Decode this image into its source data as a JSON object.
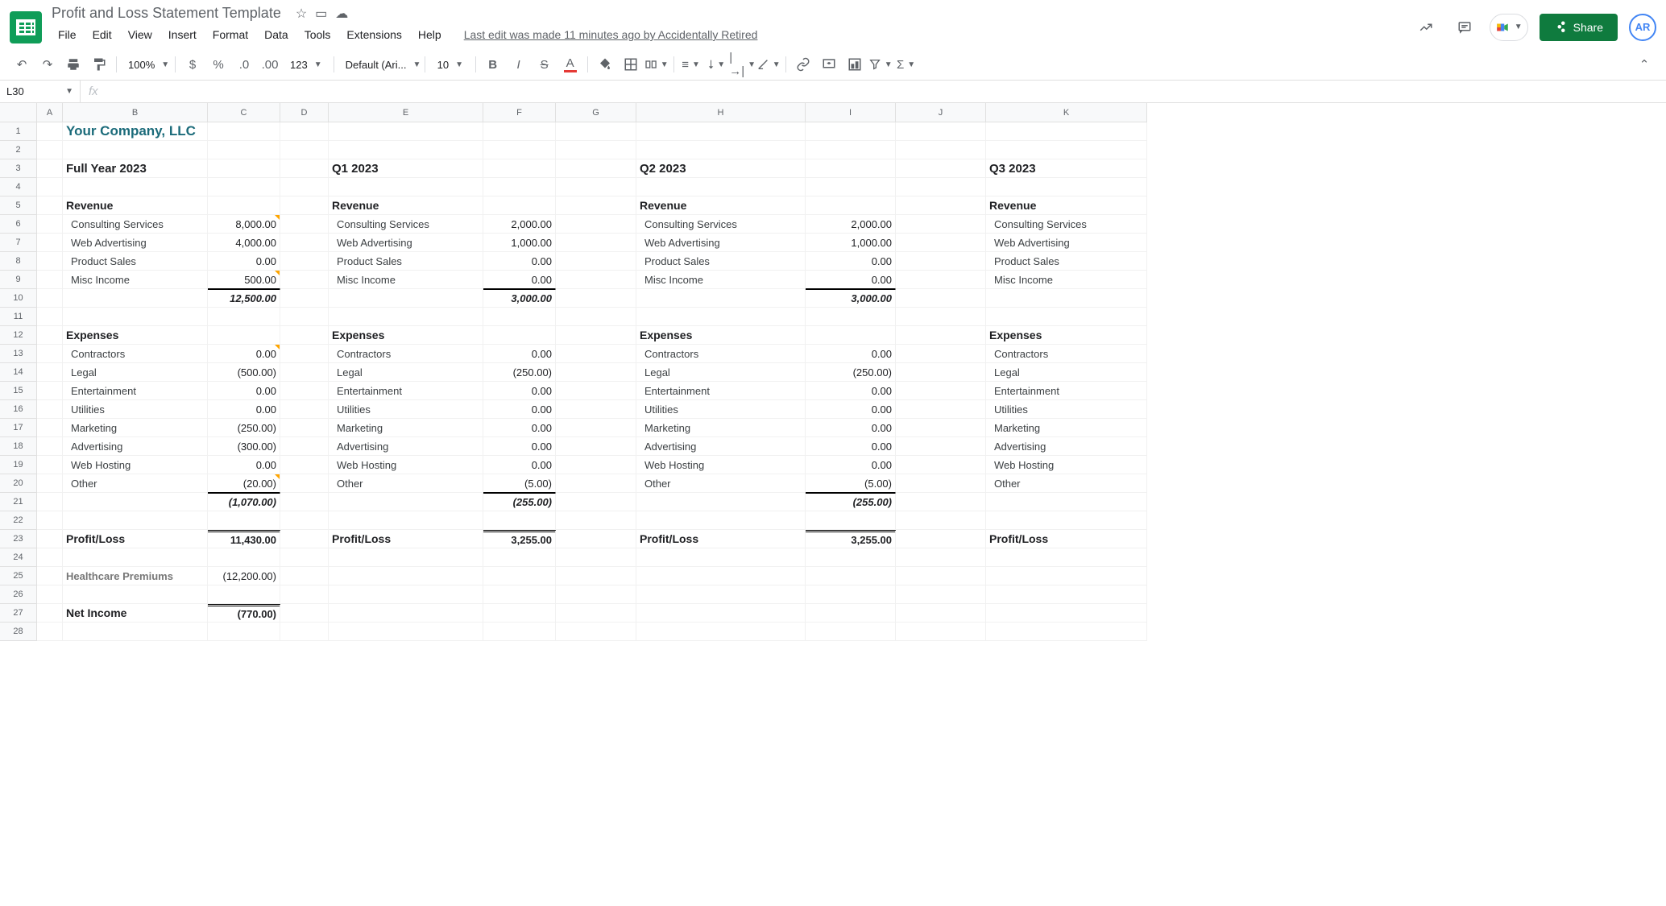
{
  "doc": {
    "title": "Profit and Loss Statement Template"
  },
  "lastEdit": "Last edit was made 11 minutes ago by Accidentally Retired",
  "menu": [
    "File",
    "Edit",
    "View",
    "Insert",
    "Format",
    "Data",
    "Tools",
    "Extensions",
    "Help"
  ],
  "share": "Share",
  "avatar": "AR",
  "toolbar": {
    "zoom": "100%",
    "font": "Default (Ari...",
    "fontSize": "10"
  },
  "nameBox": "L30",
  "columns": [
    "A",
    "B",
    "C",
    "D",
    "E",
    "F",
    "G",
    "H",
    "I",
    "J",
    "K"
  ],
  "rows": 28,
  "content": {
    "company": "Your Company, LLC",
    "fullYear": {
      "title": "Full Year 2023",
      "revenueLabel": "Revenue",
      "revenue": [
        {
          "label": "Consulting Services",
          "val": "8,000.00",
          "note": true
        },
        {
          "label": "Web Advertising",
          "val": "4,000.00"
        },
        {
          "label": "Product Sales",
          "val": "0.00"
        },
        {
          "label": "Misc Income",
          "val": "500.00",
          "note": true
        }
      ],
      "revenueTotal": "12,500.00",
      "expensesLabel": "Expenses",
      "expenses": [
        {
          "label": "Contractors",
          "val": "0.00",
          "note": true
        },
        {
          "label": "Legal",
          "val": "(500.00)"
        },
        {
          "label": "Entertainment",
          "val": "0.00"
        },
        {
          "label": "Utilities",
          "val": "0.00"
        },
        {
          "label": "Marketing",
          "val": "(250.00)"
        },
        {
          "label": "Advertising",
          "val": "(300.00)"
        },
        {
          "label": "Web Hosting",
          "val": "0.00"
        },
        {
          "label": "Other",
          "val": "(20.00)",
          "note": true
        }
      ],
      "expensesTotal": "(1,070.00)",
      "profitLabel": "Profit/Loss",
      "profit": "11,430.00",
      "healthLabel": "Healthcare Premiums",
      "health": "(12,200.00)",
      "netLabel": "Net Income",
      "net": "(770.00)"
    },
    "q1": {
      "title": "Q1 2023",
      "revenueLabel": "Revenue",
      "revenue": [
        {
          "label": "Consulting Services",
          "val": "2,000.00"
        },
        {
          "label": "Web Advertising",
          "val": "1,000.00"
        },
        {
          "label": "Product Sales",
          "val": "0.00"
        },
        {
          "label": "Misc Income",
          "val": "0.00"
        }
      ],
      "revenueTotal": "3,000.00",
      "expensesLabel": "Expenses",
      "expenses": [
        {
          "label": "Contractors",
          "val": "0.00"
        },
        {
          "label": "Legal",
          "val": "(250.00)"
        },
        {
          "label": "Entertainment",
          "val": "0.00"
        },
        {
          "label": "Utilities",
          "val": "0.00"
        },
        {
          "label": "Marketing",
          "val": "0.00"
        },
        {
          "label": "Advertising",
          "val": "0.00"
        },
        {
          "label": "Web Hosting",
          "val": "0.00"
        },
        {
          "label": "Other",
          "val": "(5.00)"
        }
      ],
      "expensesTotal": "(255.00)",
      "profitLabel": "Profit/Loss",
      "profit": "3,255.00"
    },
    "q2": {
      "title": "Q2 2023",
      "revenueLabel": "Revenue",
      "revenue": [
        {
          "label": "Consulting Services",
          "val": "2,000.00"
        },
        {
          "label": "Web Advertising",
          "val": "1,000.00"
        },
        {
          "label": "Product Sales",
          "val": "0.00"
        },
        {
          "label": "Misc Income",
          "val": "0.00"
        }
      ],
      "revenueTotal": "3,000.00",
      "expensesLabel": "Expenses",
      "expenses": [
        {
          "label": "Contractors",
          "val": "0.00"
        },
        {
          "label": "Legal",
          "val": "(250.00)"
        },
        {
          "label": "Entertainment",
          "val": "0.00"
        },
        {
          "label": "Utilities",
          "val": "0.00"
        },
        {
          "label": "Marketing",
          "val": "0.00"
        },
        {
          "label": "Advertising",
          "val": "0.00"
        },
        {
          "label": "Web Hosting",
          "val": "0.00"
        },
        {
          "label": "Other",
          "val": "(5.00)"
        }
      ],
      "expensesTotal": "(255.00)",
      "profitLabel": "Profit/Loss",
      "profit": "3,255.00"
    },
    "q3": {
      "title": "Q3 2023",
      "revenueLabel": "Revenue",
      "revenue": [
        {
          "label": "Consulting Services"
        },
        {
          "label": "Web Advertising"
        },
        {
          "label": "Product Sales"
        },
        {
          "label": "Misc Income"
        }
      ],
      "expensesLabel": "Expenses",
      "expenses": [
        {
          "label": "Contractors"
        },
        {
          "label": "Legal"
        },
        {
          "label": "Entertainment"
        },
        {
          "label": "Utilities"
        },
        {
          "label": "Marketing"
        },
        {
          "label": "Advertising"
        },
        {
          "label": "Web Hosting"
        },
        {
          "label": "Other"
        }
      ],
      "profitLabel": "Profit/Loss"
    }
  }
}
